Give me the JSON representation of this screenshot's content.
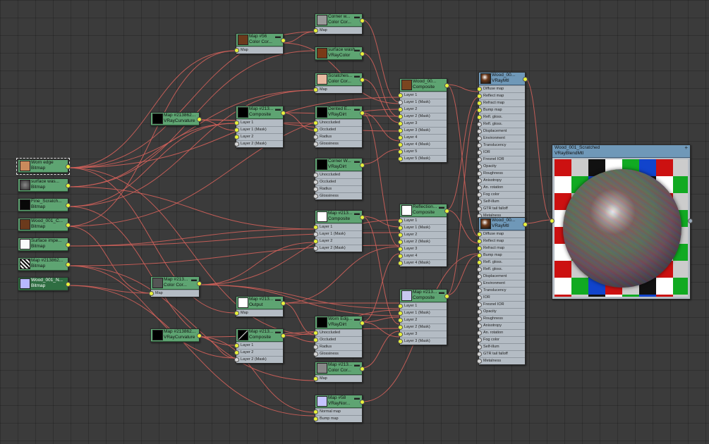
{
  "colors": {
    "wire": "#d0605a",
    "node_body": "#b4bcc4",
    "map_header": "#5ea472",
    "mtl_header": "#6f98b8",
    "socket_connected": "#e8f23a"
  },
  "nodes": {
    "worn_edge_bitmap": {
      "title": "Worn edge",
      "type": "Bitmap"
    },
    "surface_wash_bitmap": {
      "title": "surface was...",
      "type": "Bitmap"
    },
    "fine_scratch_bitmap": {
      "title": "Fine_Scratch...",
      "type": "Bitmap"
    },
    "wood_001_bitmap": {
      "title": "Wood_001_C...",
      "type": "Bitmap"
    },
    "surface_imperf_bitmap": {
      "title": "Surface impe...",
      "type": "Bitmap"
    },
    "map_213862_bitmap": {
      "title": "Map #213862...",
      "type": "Bitmap"
    },
    "wood_001_normal_bitmap": {
      "title": "Wood_001_N...",
      "type": "Bitmap"
    },
    "curvature_top": {
      "title": "Map #213862...",
      "type": "VRayCurvature"
    },
    "color_correct_mid": {
      "title": "Map #213...",
      "type": "Color Cor..."
    },
    "curvature_bottom": {
      "title": "Map #213862...",
      "type": "VRayCurvature"
    },
    "map56_cc": {
      "title": "Map #56",
      "type": "Color Cor...",
      "rows": [
        "Map"
      ]
    },
    "comp_a": {
      "title": "Map #213...",
      "type": "Composite",
      "rows": [
        "Layer 1",
        "Layer 1 (Mask)",
        "Layer 2",
        "Layer 2 (Mask)"
      ]
    },
    "output_node": {
      "title": "Map #213...",
      "type": "Output",
      "rows": [
        "Map"
      ]
    },
    "comp_b": {
      "title": "Map #213...",
      "type": "Composite",
      "rows": [
        "Layer 1",
        "Layer 2",
        "Layer 2 (Mask)"
      ]
    },
    "corner_wear_cc": {
      "title": "Corner w...",
      "type": "Color Cor...",
      "rows": [
        "Map"
      ]
    },
    "surface_wash_color": {
      "title": "surface wash...",
      "type": "VRayColor"
    },
    "scratches_cc": {
      "title": "Scratches...",
      "type": "Color Cor...",
      "rows": [
        "Map"
      ]
    },
    "dented_dirt": {
      "title": "Dented E...",
      "type": "VRayDirt",
      "rows": [
        "Unoccluded",
        "Occluded",
        "Radius",
        "Glossiness"
      ]
    },
    "corner_dirt": {
      "title": "Corner W...",
      "type": "VRayDirt",
      "rows": [
        "Unoccluded",
        "Occluded",
        "Radius",
        "Glossiness"
      ]
    },
    "comp_c": {
      "title": "Map #213...",
      "type": "Composite",
      "rows": [
        "Layer 1",
        "Layer 1 (Mask)",
        "Layer 2",
        "Layer 2 (Mask)"
      ]
    },
    "worn_edge_dirt": {
      "title": "Worn Edg...",
      "type": "VRayDirt",
      "rows": [
        "Unoccluded",
        "Occluded",
        "Radius",
        "Glossiness"
      ]
    },
    "cc_lower": {
      "title": "Map #213...",
      "type": "Color Cor...",
      "rows": [
        "Map"
      ]
    },
    "normal_map": {
      "title": "Map #58",
      "type": "VRayNor...",
      "rows": [
        "Normal map",
        "Bump map"
      ]
    },
    "wood_composite": {
      "title": "Wood_00...",
      "type": "Composite",
      "rows": [
        "Layer 1",
        "Layer 1 (Mask)",
        "Layer 2",
        "Layer 2 (Mask)",
        "Layer 3",
        "Layer 3 (Mask)",
        "Layer 4",
        "Layer 4 (Mask)",
        "Layer 5",
        "Layer 5 (Mask)"
      ]
    },
    "reflection_composite": {
      "title": "Reflection...",
      "type": "Composite",
      "rows": [
        "Layer 1",
        "Layer 1 (Mask)",
        "Layer 2",
        "Layer 2 (Mask)",
        "Layer 3",
        "Layer 4",
        "Layer 4 (Mask)"
      ]
    },
    "comp_lower": {
      "title": "Map #213...",
      "type": "Composite",
      "rows": [
        "Layer 1",
        "Layer 1 (Mask)",
        "Layer 2",
        "Layer 2 (Mask)",
        "Layer 3",
        "Layer 3 (Mask)"
      ]
    },
    "vraymtl_top": {
      "title": "Wood_00...",
      "type": "VRayMtl",
      "rows": [
        "Diffuse map",
        "Reflect map",
        "Refract map",
        "Bump map",
        "Refl. gloss.",
        "Refl. gloss.",
        "Displacement",
        "Environment",
        "Translucency",
        "IOR",
        "Fresnel IOR",
        "Opacity",
        "Roughness",
        "Anisotropy",
        "An. rotation",
        "Fog color",
        "Self-illum",
        "GTR tail falloff",
        "Metalness"
      ]
    },
    "vraymtl_bottom": {
      "title": "Wood_00...",
      "type": "VRayMtl",
      "rows": [
        "Diffuse map",
        "Reflect map",
        "Refract map",
        "Bump map",
        "Refl. gloss.",
        "Refl. gloss.",
        "Displacement",
        "Environment",
        "Translucency",
        "IOR",
        "Fresnel IOR",
        "Opacity",
        "Roughness",
        "Anisotropy",
        "An. rotation",
        "Fog color",
        "Self-illum",
        "GTR tail falloff",
        "Metalness"
      ]
    },
    "blend_mtl": {
      "title": "Wood_001_Scratched",
      "type": "VRayBlendMtl"
    }
  }
}
